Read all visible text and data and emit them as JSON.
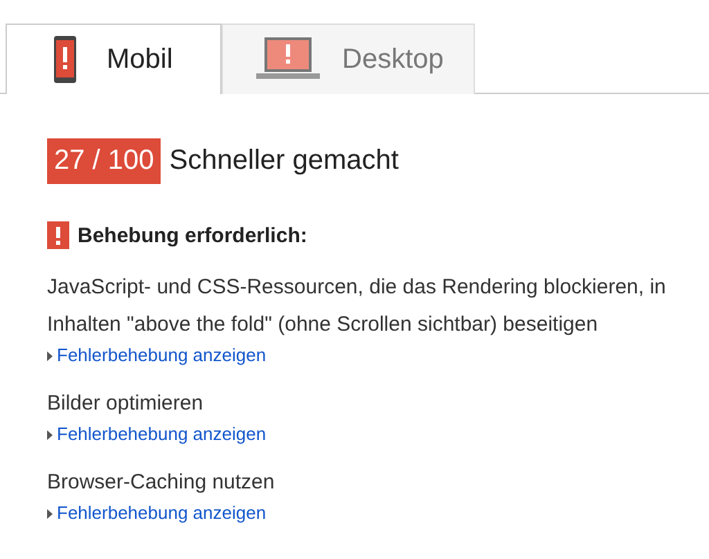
{
  "tabs": [
    {
      "label": "Mobil",
      "kind": "mobile",
      "selected": true
    },
    {
      "label": "Desktop",
      "kind": "desktop",
      "selected": false
    }
  ],
  "score": {
    "value": "27 / 100",
    "label": "Schneller gemacht"
  },
  "section": {
    "title": "Behebung erforderlich:"
  },
  "rules": [
    {
      "title": "JavaScript- und CSS-Ressourcen, die das Rendering blockieren, in Inhalten \"above the fold\" (ohne Scrollen sichtbar) beseitigen",
      "link": "Fehlerbehebung anzeigen"
    },
    {
      "title": "Bilder optimieren",
      "link": "Fehlerbehebung anzeigen"
    },
    {
      "title": "Browser-Caching nutzen",
      "link": "Fehlerbehebung anzeigen"
    }
  ]
}
